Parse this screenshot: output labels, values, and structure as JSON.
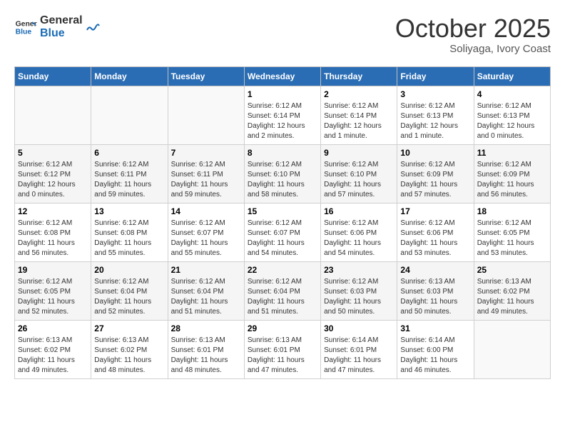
{
  "header": {
    "logo_line1": "General",
    "logo_line2": "Blue",
    "month": "October 2025",
    "location": "Soliyaga, Ivory Coast"
  },
  "days_of_week": [
    "Sunday",
    "Monday",
    "Tuesday",
    "Wednesday",
    "Thursday",
    "Friday",
    "Saturday"
  ],
  "weeks": [
    [
      {
        "day": "",
        "info": ""
      },
      {
        "day": "",
        "info": ""
      },
      {
        "day": "",
        "info": ""
      },
      {
        "day": "1",
        "info": "Sunrise: 6:12 AM\nSunset: 6:14 PM\nDaylight: 12 hours and 2 minutes."
      },
      {
        "day": "2",
        "info": "Sunrise: 6:12 AM\nSunset: 6:14 PM\nDaylight: 12 hours and 1 minute."
      },
      {
        "day": "3",
        "info": "Sunrise: 6:12 AM\nSunset: 6:13 PM\nDaylight: 12 hours and 1 minute."
      },
      {
        "day": "4",
        "info": "Sunrise: 6:12 AM\nSunset: 6:13 PM\nDaylight: 12 hours and 0 minutes."
      }
    ],
    [
      {
        "day": "5",
        "info": "Sunrise: 6:12 AM\nSunset: 6:12 PM\nDaylight: 12 hours and 0 minutes."
      },
      {
        "day": "6",
        "info": "Sunrise: 6:12 AM\nSunset: 6:11 PM\nDaylight: 11 hours and 59 minutes."
      },
      {
        "day": "7",
        "info": "Sunrise: 6:12 AM\nSunset: 6:11 PM\nDaylight: 11 hours and 59 minutes."
      },
      {
        "day": "8",
        "info": "Sunrise: 6:12 AM\nSunset: 6:10 PM\nDaylight: 11 hours and 58 minutes."
      },
      {
        "day": "9",
        "info": "Sunrise: 6:12 AM\nSunset: 6:10 PM\nDaylight: 11 hours and 57 minutes."
      },
      {
        "day": "10",
        "info": "Sunrise: 6:12 AM\nSunset: 6:09 PM\nDaylight: 11 hours and 57 minutes."
      },
      {
        "day": "11",
        "info": "Sunrise: 6:12 AM\nSunset: 6:09 PM\nDaylight: 11 hours and 56 minutes."
      }
    ],
    [
      {
        "day": "12",
        "info": "Sunrise: 6:12 AM\nSunset: 6:08 PM\nDaylight: 11 hours and 56 minutes."
      },
      {
        "day": "13",
        "info": "Sunrise: 6:12 AM\nSunset: 6:08 PM\nDaylight: 11 hours and 55 minutes."
      },
      {
        "day": "14",
        "info": "Sunrise: 6:12 AM\nSunset: 6:07 PM\nDaylight: 11 hours and 55 minutes."
      },
      {
        "day": "15",
        "info": "Sunrise: 6:12 AM\nSunset: 6:07 PM\nDaylight: 11 hours and 54 minutes."
      },
      {
        "day": "16",
        "info": "Sunrise: 6:12 AM\nSunset: 6:06 PM\nDaylight: 11 hours and 54 minutes."
      },
      {
        "day": "17",
        "info": "Sunrise: 6:12 AM\nSunset: 6:06 PM\nDaylight: 11 hours and 53 minutes."
      },
      {
        "day": "18",
        "info": "Sunrise: 6:12 AM\nSunset: 6:05 PM\nDaylight: 11 hours and 53 minutes."
      }
    ],
    [
      {
        "day": "19",
        "info": "Sunrise: 6:12 AM\nSunset: 6:05 PM\nDaylight: 11 hours and 52 minutes."
      },
      {
        "day": "20",
        "info": "Sunrise: 6:12 AM\nSunset: 6:04 PM\nDaylight: 11 hours and 52 minutes."
      },
      {
        "day": "21",
        "info": "Sunrise: 6:12 AM\nSunset: 6:04 PM\nDaylight: 11 hours and 51 minutes."
      },
      {
        "day": "22",
        "info": "Sunrise: 6:12 AM\nSunset: 6:04 PM\nDaylight: 11 hours and 51 minutes."
      },
      {
        "day": "23",
        "info": "Sunrise: 6:12 AM\nSunset: 6:03 PM\nDaylight: 11 hours and 50 minutes."
      },
      {
        "day": "24",
        "info": "Sunrise: 6:13 AM\nSunset: 6:03 PM\nDaylight: 11 hours and 50 minutes."
      },
      {
        "day": "25",
        "info": "Sunrise: 6:13 AM\nSunset: 6:02 PM\nDaylight: 11 hours and 49 minutes."
      }
    ],
    [
      {
        "day": "26",
        "info": "Sunrise: 6:13 AM\nSunset: 6:02 PM\nDaylight: 11 hours and 49 minutes."
      },
      {
        "day": "27",
        "info": "Sunrise: 6:13 AM\nSunset: 6:02 PM\nDaylight: 11 hours and 48 minutes."
      },
      {
        "day": "28",
        "info": "Sunrise: 6:13 AM\nSunset: 6:01 PM\nDaylight: 11 hours and 48 minutes."
      },
      {
        "day": "29",
        "info": "Sunrise: 6:13 AM\nSunset: 6:01 PM\nDaylight: 11 hours and 47 minutes."
      },
      {
        "day": "30",
        "info": "Sunrise: 6:14 AM\nSunset: 6:01 PM\nDaylight: 11 hours and 47 minutes."
      },
      {
        "day": "31",
        "info": "Sunrise: 6:14 AM\nSunset: 6:00 PM\nDaylight: 11 hours and 46 minutes."
      },
      {
        "day": "",
        "info": ""
      }
    ]
  ]
}
